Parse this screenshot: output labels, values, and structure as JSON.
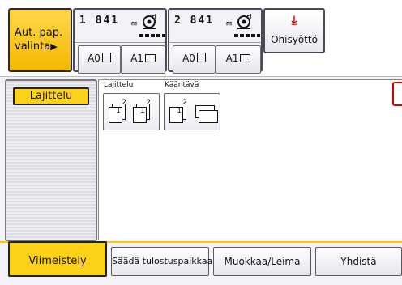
{
  "paper": {
    "auto_select_line1": "Aut. pap.",
    "auto_select_line2": "valinta",
    "auto_select_arrow": "▶",
    "trays": [
      {
        "width": "1 841",
        "unit": "㎜",
        "sizes": [
          "A0",
          "A1"
        ]
      },
      {
        "width": "2 841",
        "unit": "㎜",
        "sizes": [
          "A0",
          "A1"
        ]
      }
    ],
    "bypass_label": "Ohisyöttö",
    "bypass_icon": "download-arrow-icon"
  },
  "sidebar": {
    "active_item": "Lajittelu"
  },
  "options": {
    "sort_label": "Lajittelu",
    "rotate_label": "Kääntävä",
    "page_marks": [
      "1",
      "2"
    ]
  },
  "bottom_tabs": [
    {
      "label": "Viimeistely",
      "active": true
    },
    {
      "label": "Säädä tulostuspaikkaa",
      "active": false
    },
    {
      "label": "Muokkaa/Leima",
      "active": false
    },
    {
      "label": "Yhdistä",
      "active": false
    }
  ],
  "colors": {
    "accent": "#ffd21a",
    "bypass_arrow": "#d40000"
  }
}
